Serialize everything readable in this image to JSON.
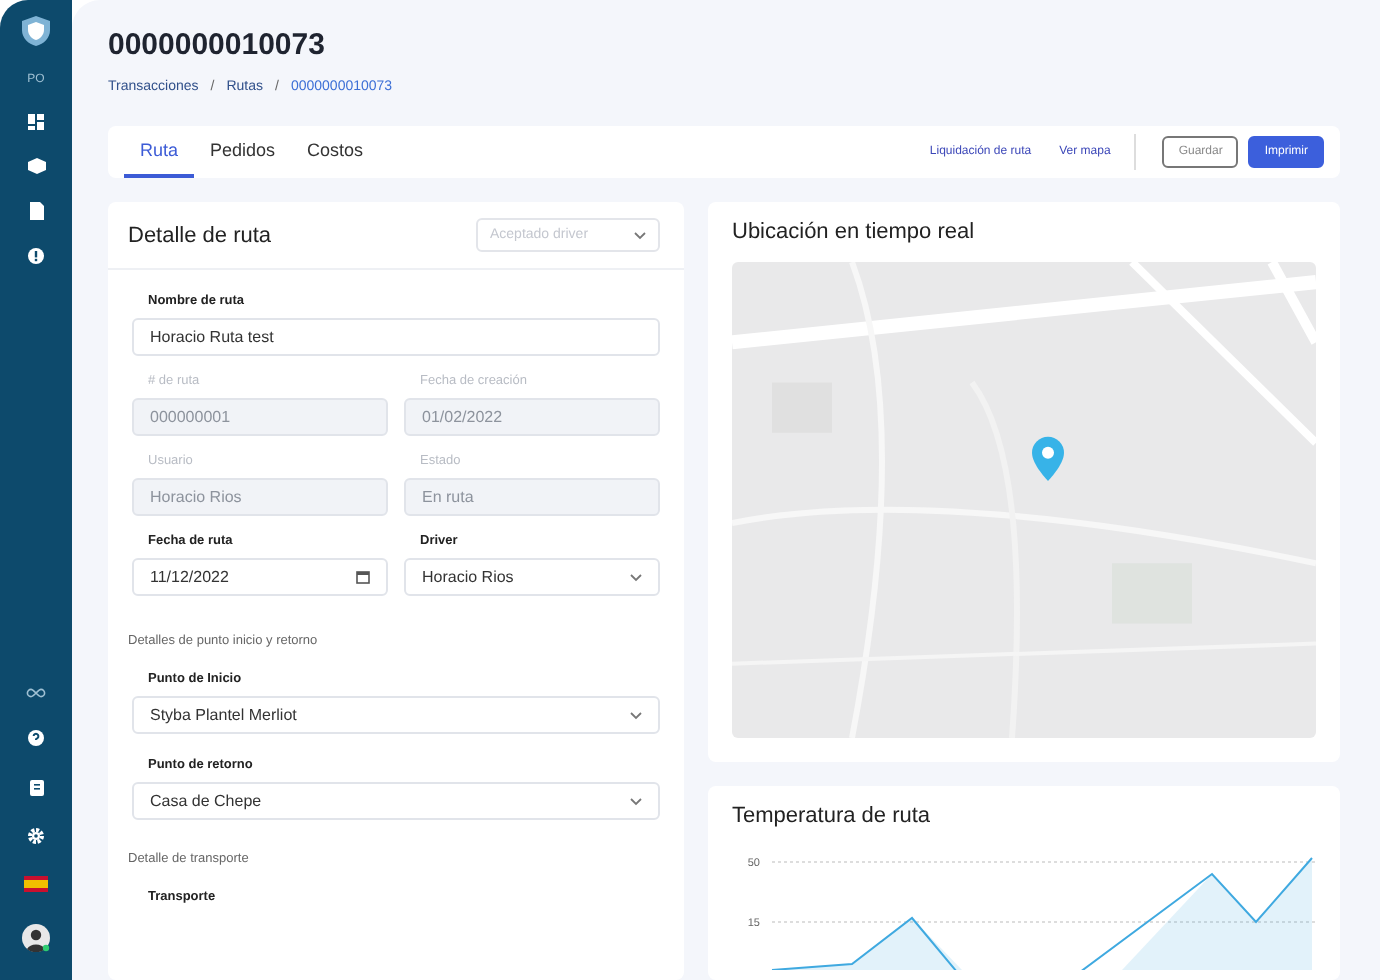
{
  "sidebar": {
    "user_initials": "PO",
    "items": [
      {
        "kind": "dashboard"
      },
      {
        "kind": "box"
      },
      {
        "kind": "document"
      },
      {
        "kind": "info"
      }
    ],
    "bottom_items": [
      {
        "kind": "infinity"
      },
      {
        "kind": "help"
      },
      {
        "kind": "clipboard"
      },
      {
        "kind": "settings"
      },
      {
        "kind": "flag"
      },
      {
        "kind": "avatar"
      }
    ]
  },
  "page": {
    "title": "0000000010073",
    "breadcrumb": [
      {
        "label": "Transacciones",
        "current": false
      },
      {
        "label": "Rutas",
        "current": false
      },
      {
        "label": "0000000010073",
        "current": true
      }
    ],
    "separator": "/"
  },
  "tabs": [
    {
      "label": "Ruta",
      "selected": true
    },
    {
      "label": "Pedidos",
      "selected": false
    },
    {
      "label": "Costos",
      "selected": false
    }
  ],
  "actions": {
    "links": [
      "Liquidación de ruta",
      "Ver mapa"
    ],
    "buttons": [
      {
        "label": "Guardar",
        "kind": "outline"
      },
      {
        "label": "Imprimir",
        "kind": "primary"
      }
    ]
  },
  "detail": {
    "title": "Detalle de ruta",
    "status_select": {
      "placeholder": "Aceptado driver"
    },
    "rows": [
      [
        {
          "label": "Nombre de ruta",
          "value": "Horacio Ruta test",
          "kind": "text",
          "disabled": false
        }
      ],
      [
        {
          "label": "# de ruta",
          "value": "000000001",
          "kind": "text",
          "disabled": true
        },
        {
          "label": "Fecha de creación",
          "value": "01/02/2022",
          "kind": "text",
          "disabled": true
        }
      ],
      [
        {
          "label": "Usuario",
          "value": "Horacio Rios",
          "kind": "text",
          "disabled": true
        },
        {
          "label": "Estado",
          "value": "En ruta",
          "kind": "text",
          "disabled": true
        }
      ],
      [
        {
          "label": "Fecha de ruta",
          "value": "11/12/2022",
          "kind": "date",
          "disabled": false
        },
        {
          "label": "Driver",
          "value": "Horacio Rios",
          "kind": "select",
          "disabled": false
        }
      ]
    ],
    "sections": [
      {
        "title": "Detalles de punto inicio y retorno",
        "fields": [
          {
            "label": "Punto de Inicio",
            "value": "Styba Plantel Merliot",
            "kind": "select",
            "disabled": false
          },
          {
            "label": "Punto de retorno",
            "value": "Casa de Chepe",
            "kind": "select",
            "disabled": false
          }
        ]
      },
      {
        "title": "Detalle de transporte",
        "fields": [
          {
            "label": "Transporte",
            "kind": "label"
          }
        ]
      }
    ]
  },
  "map_card": {
    "title": "Ubicación en tiempo real"
  },
  "temperature_card": {
    "title": "Temperatura de ruta",
    "axis_labels": [
      "50",
      "15"
    ]
  }
}
